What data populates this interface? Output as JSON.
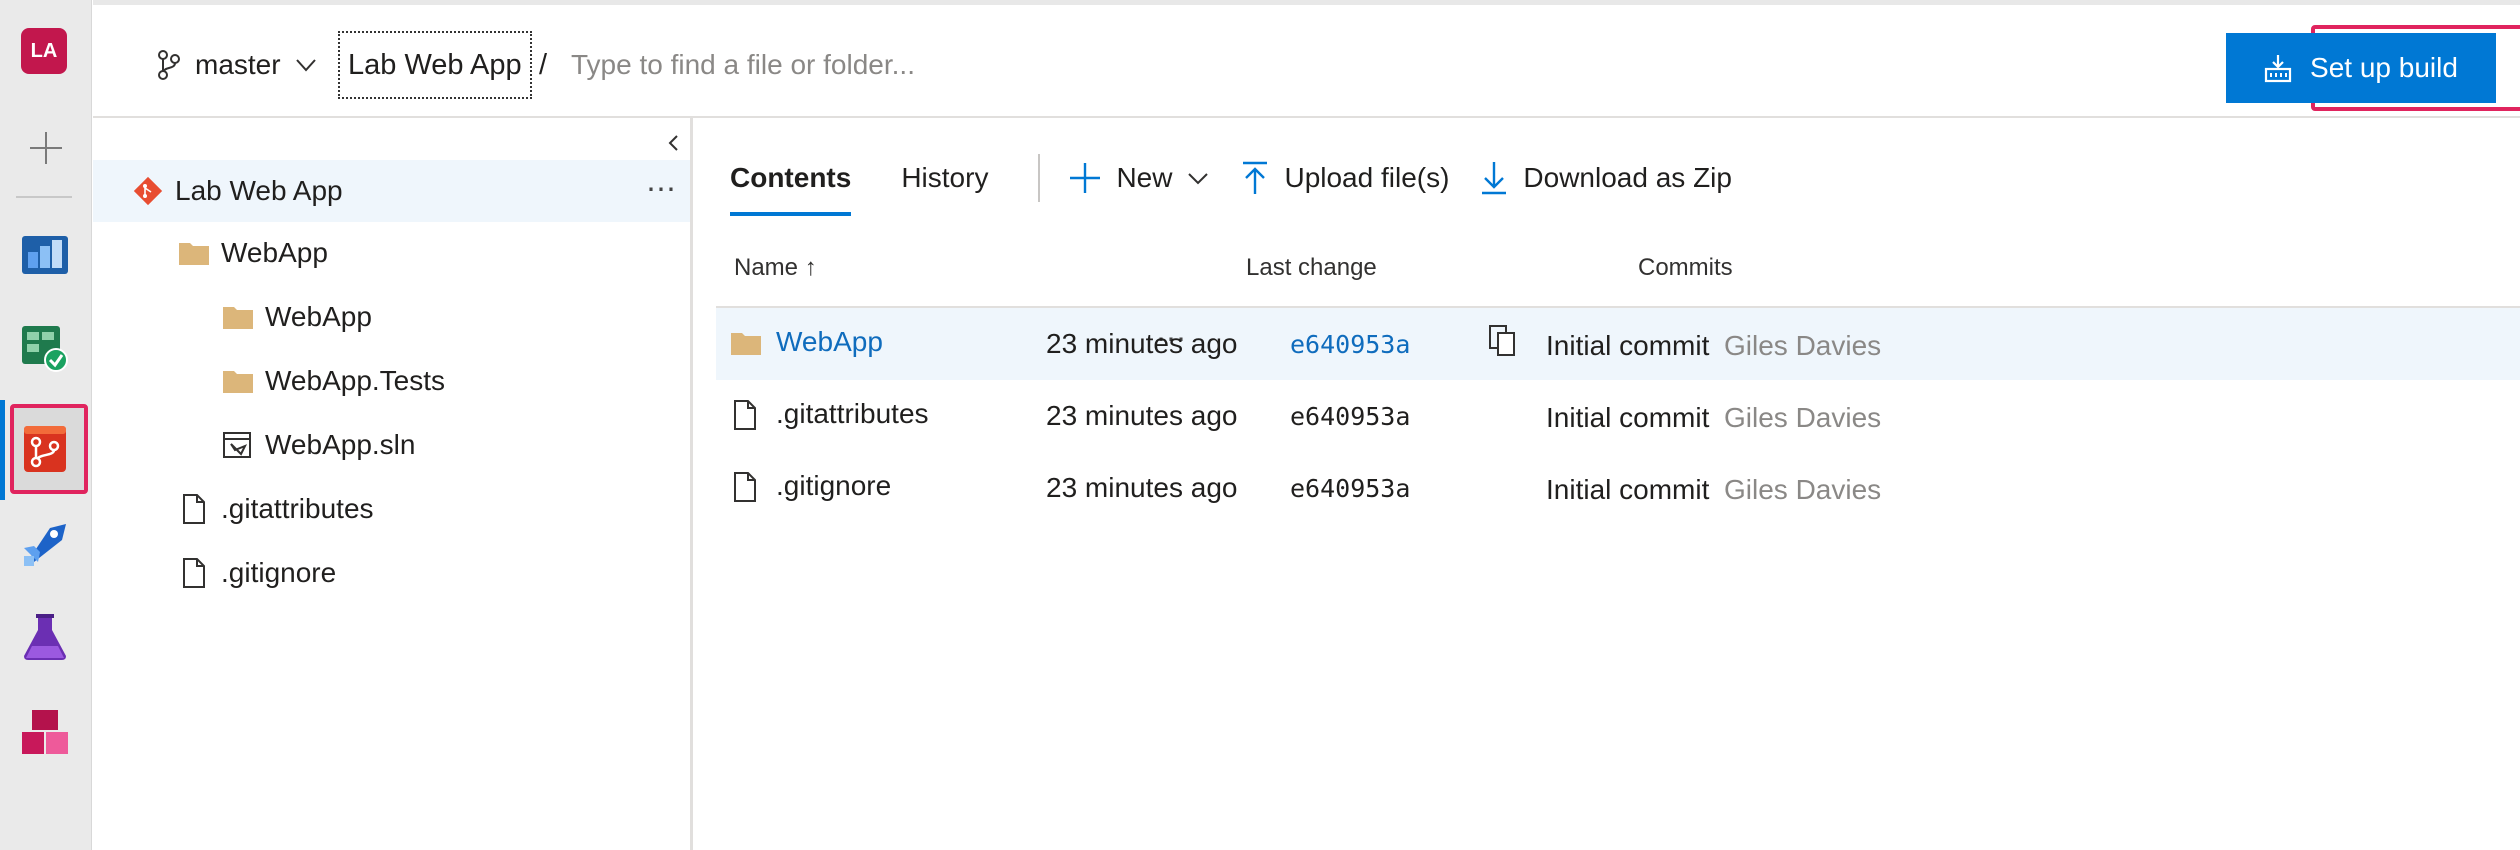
{
  "rail": {
    "avatar": "LA",
    "items": [
      "boards-icon",
      "test-plans-icon",
      "repos-icon",
      "pipelines-icon",
      "test-icon",
      "artifacts-icon"
    ]
  },
  "topbar": {
    "branch": "master",
    "repo": "Lab Web App",
    "separator": "/",
    "search_placeholder": "Type to find a file or folder...",
    "setup_build_label": "Set up build"
  },
  "tree": {
    "root": "Lab Web App",
    "more": "⋯",
    "items": [
      {
        "label": "WebApp",
        "type": "folder"
      },
      {
        "label": "WebApp",
        "type": "folder"
      },
      {
        "label": "WebApp.Tests",
        "type": "folder"
      },
      {
        "label": "WebApp.sln",
        "type": "solution"
      },
      {
        "label": ".gitattributes",
        "type": "file"
      },
      {
        "label": ".gitignore",
        "type": "file"
      }
    ]
  },
  "main": {
    "tabs": [
      "Contents",
      "History"
    ],
    "commands": {
      "new": "New",
      "upload": "Upload file(s)",
      "download": "Download as Zip"
    },
    "columns": {
      "name": "Name ↑",
      "last_change": "Last change",
      "commits": "Commits"
    },
    "rows": [
      {
        "name": "WebApp",
        "type": "folder",
        "more": "⋯",
        "last_change": "23 minutes ago",
        "commit": "e640953a",
        "message": "Initial commit",
        "author": "Giles Davies"
      },
      {
        "name": ".gitattributes",
        "type": "file",
        "last_change": "23 minutes ago",
        "commit": "e640953a",
        "message": "Initial commit",
        "author": "Giles Davies"
      },
      {
        "name": ".gitignore",
        "type": "file",
        "last_change": "23 minutes ago",
        "commit": "e640953a",
        "message": "Initial commit",
        "author": "Giles Davies"
      }
    ]
  },
  "colors": {
    "accent": "#0078d4",
    "highlight": "#e0245e",
    "folder": "#dcb67a",
    "selected_row": "#eff6fc"
  }
}
